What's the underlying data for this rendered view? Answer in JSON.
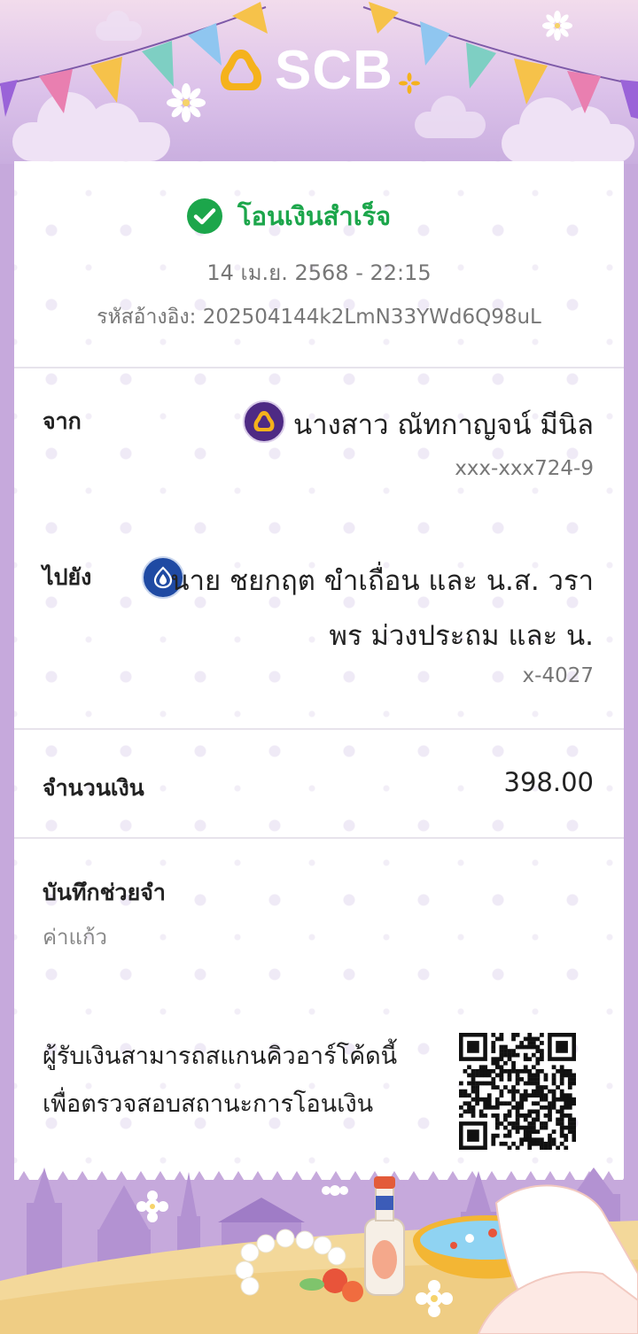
{
  "brand": {
    "name": "SCB",
    "color": "#4e2a84"
  },
  "status": {
    "text": "โอนเงินสำเร็จ",
    "color": "#1ca64b",
    "icon": "check-circle-icon"
  },
  "datetime": "14 เม.ย. 2568 - 22:15",
  "reference": {
    "label": "รหัสอ้างอิง:",
    "value": "202504144k2LmN33YWd6Q98uL"
  },
  "from": {
    "label": "จาก",
    "name": "นางสาว ณัทกาญจน์ มีนิล",
    "account": "xxx-xxx724-9",
    "bank_icon": "scb-bank-icon"
  },
  "to": {
    "label": "ไปยัง",
    "name_line1": "นาย ชยกฤต ขำเถื่อน และ น.ส. วรา",
    "name_line2": "พร ม่วงประถม และ น.",
    "account": "x-4027",
    "bank_icon": "bbl-bank-icon"
  },
  "amount": {
    "label": "จำนวนเงิน",
    "value": "398.00"
  },
  "memo": {
    "label": "บันทึกช่วยจำ",
    "value": "ค่าแก้ว"
  },
  "qr": {
    "line1": "ผู้รับเงินสามารถสแกนคิวอาร์โค้ดนี้",
    "line2": "เพื่อตรวจสอบสถานะการโอนเงิน"
  }
}
